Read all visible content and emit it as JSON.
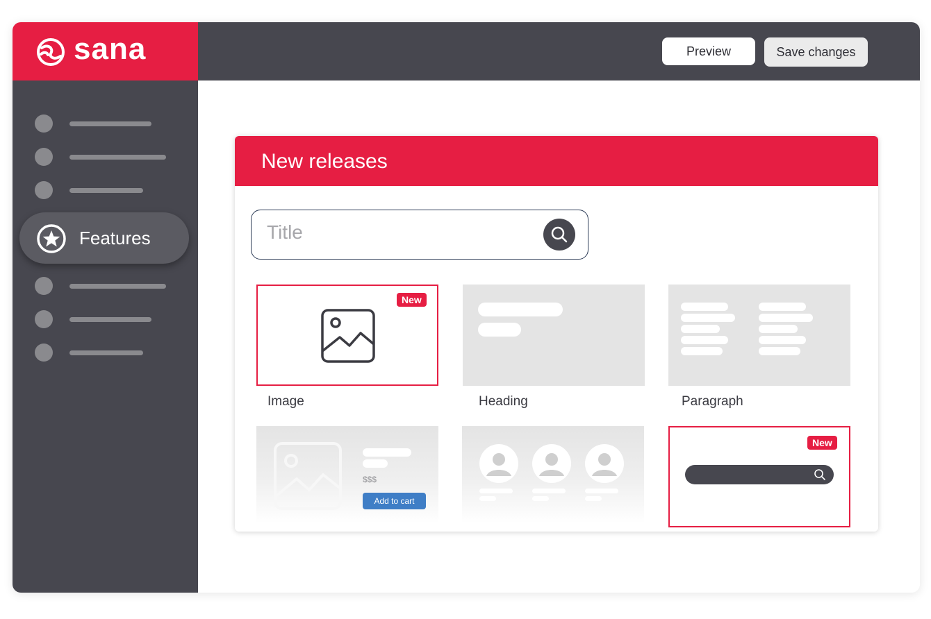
{
  "brand": {
    "name": "sana",
    "color": "#e61e43"
  },
  "toolbar": {
    "preview_label": "Preview",
    "save_label": "Save changes"
  },
  "sidebar": {
    "active_item": {
      "label": "Features",
      "icon": "star-icon"
    }
  },
  "panel": {
    "title": "New releases",
    "search": {
      "placeholder": "Title",
      "icon": "search-icon"
    },
    "tiles": [
      {
        "label": "Image",
        "badge": "New",
        "icon": "image-icon"
      },
      {
        "label": "Heading"
      },
      {
        "label": "Paragraph"
      },
      {
        "price": "$$$",
        "button_label": "Add to cart",
        "icon": "image-icon"
      },
      {
        "icon": "user-icon"
      },
      {
        "badge": "New",
        "icon": "search-icon"
      }
    ]
  },
  "colors": {
    "sidebar": "#47474f",
    "accent": "#e61e43",
    "cart_button": "#3f7ec6"
  }
}
